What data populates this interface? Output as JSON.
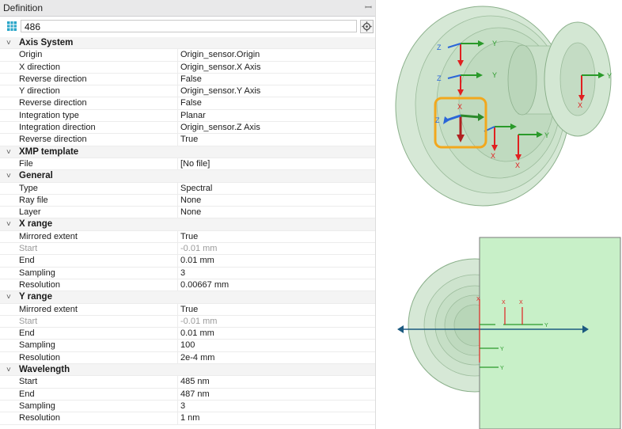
{
  "panel": {
    "title": "Definition",
    "name_value": "486",
    "groups": [
      {
        "label": "Axis System",
        "rows": [
          {
            "label": "Origin",
            "value": "Origin_sensor.Origin"
          },
          {
            "label": "X direction",
            "value": "Origin_sensor.X Axis"
          },
          {
            "label": "Reverse direction",
            "value": "False"
          },
          {
            "label": "Y direction",
            "value": "Origin_sensor.Y Axis"
          },
          {
            "label": "Reverse direction",
            "value": "False"
          },
          {
            "label": "Integration type",
            "value": "Planar"
          },
          {
            "label": "Integration direction",
            "value": "Origin_sensor.Z Axis"
          },
          {
            "label": "Reverse direction",
            "value": "True"
          }
        ]
      },
      {
        "label": "XMP template",
        "rows": [
          {
            "label": "File",
            "value": "[No file]"
          }
        ]
      },
      {
        "label": "General",
        "rows": [
          {
            "label": "Type",
            "value": "Spectral"
          },
          {
            "label": "Ray file",
            "value": "None"
          },
          {
            "label": "Layer",
            "value": "None"
          }
        ]
      },
      {
        "label": "X range",
        "rows": [
          {
            "label": "Mirrored extent",
            "value": "True"
          },
          {
            "label": "Start",
            "value": "-0.01 mm",
            "disabled": true
          },
          {
            "label": "End",
            "value": "0.01 mm"
          },
          {
            "label": "Sampling",
            "value": "3"
          },
          {
            "label": "Resolution",
            "value": "0.00667 mm"
          }
        ]
      },
      {
        "label": "Y range",
        "rows": [
          {
            "label": "Mirrored extent",
            "value": "True"
          },
          {
            "label": "Start",
            "value": "-0.01 mm",
            "disabled": true
          },
          {
            "label": "End",
            "value": "0.01 mm"
          },
          {
            "label": "Sampling",
            "value": "100"
          },
          {
            "label": "Resolution",
            "value": "2e-4 mm"
          }
        ]
      },
      {
        "label": "Wavelength",
        "rows": [
          {
            "label": "Start",
            "value": "485 nm"
          },
          {
            "label": "End",
            "value": "487 nm"
          },
          {
            "label": "Sampling",
            "value": "3"
          },
          {
            "label": "Resolution",
            "value": "1 nm"
          }
        ]
      }
    ]
  },
  "axis_labels": {
    "x": "X",
    "y": "Y",
    "z": "Z"
  },
  "icons": {
    "sensor": "sensor-grid-icon",
    "settings": "gear-icon",
    "pin": "pin-icon",
    "expand": "chevron-down-icon"
  },
  "colors": {
    "x_axis": "#e02020",
    "y_axis": "#2a9a2a",
    "z_axis": "#2a66d8",
    "highlight": "#f2a81d",
    "lens_fill": "#cfe6cf",
    "sensor_plane": "#c8f0c8",
    "ray": "#1c5a80"
  }
}
